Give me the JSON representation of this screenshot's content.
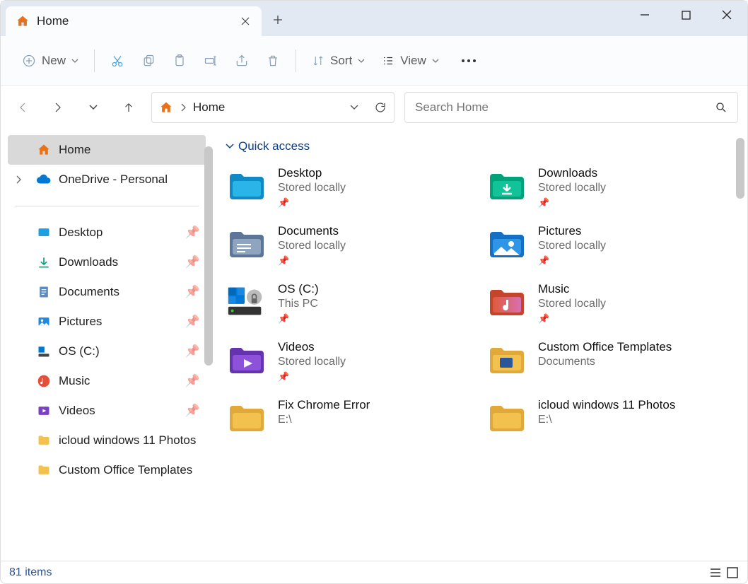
{
  "window": {
    "tab_title": "Home"
  },
  "toolbar": {
    "new_label": "New",
    "sort_label": "Sort",
    "view_label": "View"
  },
  "address": {
    "crumb": "Home"
  },
  "search": {
    "placeholder": "Search Home"
  },
  "sidebar": {
    "home": "Home",
    "onedrive": "OneDrive - Personal",
    "items": [
      {
        "label": "Desktop"
      },
      {
        "label": "Downloads"
      },
      {
        "label": "Documents"
      },
      {
        "label": "Pictures"
      },
      {
        "label": "OS (C:)"
      },
      {
        "label": "Music"
      },
      {
        "label": "Videos"
      },
      {
        "label": "icloud windows 11 Photos"
      },
      {
        "label": "Custom Office Templates"
      }
    ]
  },
  "content": {
    "section": "Quick access",
    "items": [
      {
        "name": "Desktop",
        "sub": "Stored locally",
        "pinned": true
      },
      {
        "name": "Downloads",
        "sub": "Stored locally",
        "pinned": true
      },
      {
        "name": "Documents",
        "sub": "Stored locally",
        "pinned": true
      },
      {
        "name": "Pictures",
        "sub": "Stored locally",
        "pinned": true
      },
      {
        "name": "OS (C:)",
        "sub": "This PC",
        "pinned": true
      },
      {
        "name": "Music",
        "sub": "Stored locally",
        "pinned": true
      },
      {
        "name": "Videos",
        "sub": "Stored locally",
        "pinned": true
      },
      {
        "name": "Custom Office Templates",
        "sub": "Documents",
        "pinned": false
      },
      {
        "name": "Fix Chrome Error",
        "sub": "E:\\",
        "pinned": false
      },
      {
        "name": "icloud windows 11 Photos",
        "sub": "E:\\",
        "pinned": false
      }
    ]
  },
  "status": {
    "text": "81 items"
  }
}
